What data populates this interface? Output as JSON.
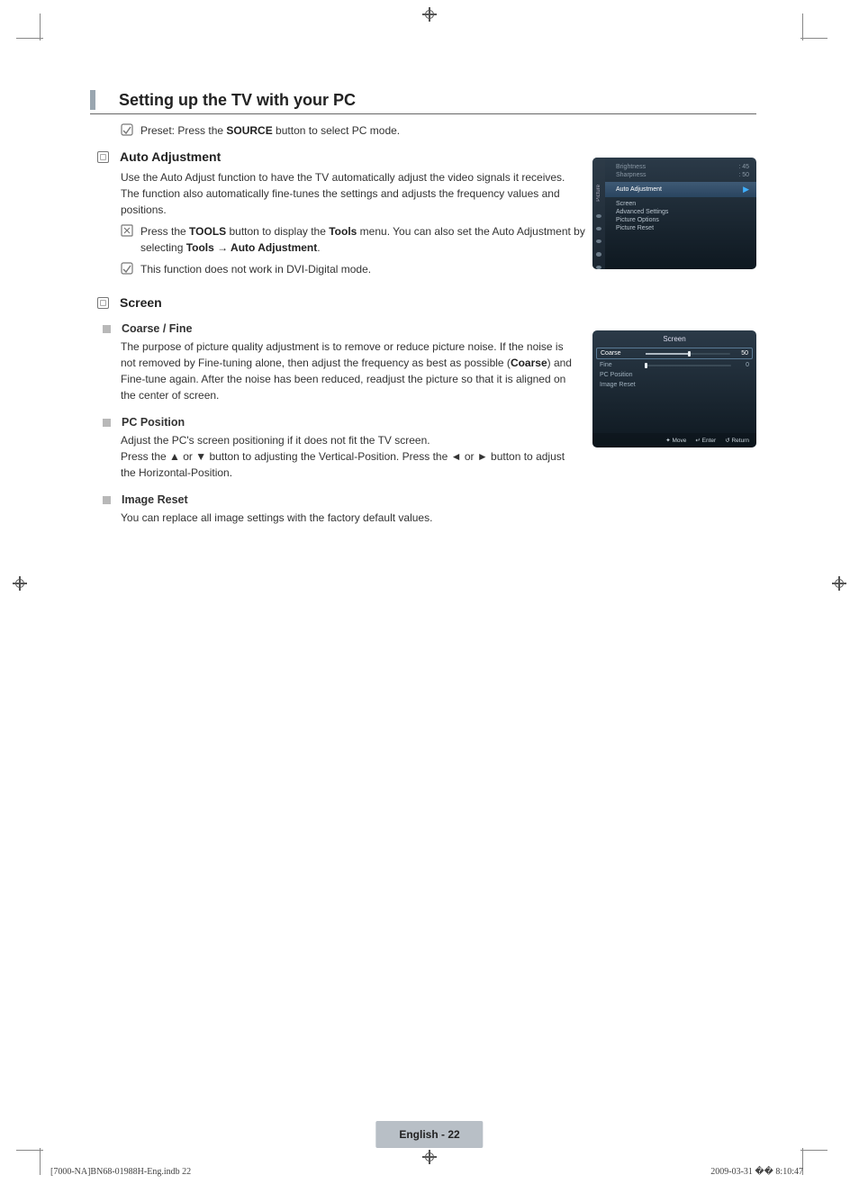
{
  "title": "Setting up the TV with your PC",
  "preset_prefix": "Preset: Press the ",
  "preset_bold": "SOURCE",
  "preset_suffix": " button to select PC mode.",
  "sections": {
    "auto_adjustment": {
      "heading": "Auto Adjustment",
      "body": "Use the Auto Adjust function to have the TV automatically adjust the video signals it receives. The function also automatically fine-tunes the settings and adjusts the frequency values and positions.",
      "tools_prefix": "Press the ",
      "tools_bold1": "TOOLS",
      "tools_mid1": " button to display the ",
      "tools_bold2": "Tools",
      "tools_mid2": " menu. You can also set the Auto Adjustment by selecting ",
      "tools_bold3": "Tools → Auto Adjustment",
      "tools_suffix": ".",
      "note2": "This function does not work in DVI-Digital mode."
    },
    "screen": {
      "heading": "Screen",
      "coarse_fine": {
        "heading": "Coarse / Fine",
        "body_prefix": "The purpose of picture quality adjustment is to remove or reduce picture noise. If the noise is not removed by Fine-tuning alone, then adjust the frequency as best as possible (",
        "body_bold": "Coarse",
        "body_suffix": ") and Fine-tune again. After the noise has been reduced, readjust the picture so that it is aligned on the center of screen."
      },
      "pc_position": {
        "heading": "PC Position",
        "line1": "Adjust the PC's screen positioning if it does not fit the TV screen.",
        "line2": "Press the ▲ or ▼ button to adjusting the Vertical-Position. Press the ◄ or ► button to adjust the Horizontal-Position."
      },
      "image_reset": {
        "heading": "Image Reset",
        "body": "You can replace all image settings with the factory default values."
      }
    }
  },
  "osd1": {
    "sidebar_label": "Picture",
    "brightness_label": "Brightness",
    "brightness_value": ": 45",
    "sharpness_label": "Sharpness",
    "sharpness_value": ": 50",
    "highlight": "Auto Adjustment",
    "items": [
      "Screen",
      "Advanced Settings",
      "Picture Options",
      "Picture Reset"
    ]
  },
  "osd2": {
    "title": "Screen",
    "coarse_label": "Coarse",
    "coarse_value": "50",
    "fine_label": "Fine",
    "fine_value": "0",
    "pc_position": "PC Position",
    "image_reset": "Image Reset",
    "footer_move": "Move",
    "footer_enter": "Enter",
    "footer_return": "Return"
  },
  "footer": {
    "page_label": "English - 22",
    "doc_left": "[7000-NA]BN68-01988H-Eng.indb   22",
    "doc_right": "2009-03-31   �� 8:10:47"
  }
}
